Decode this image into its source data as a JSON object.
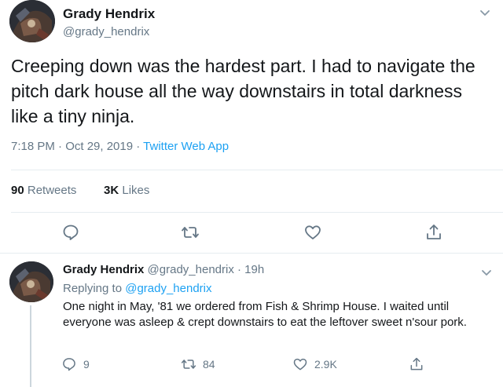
{
  "main_tweet": {
    "author_name": "Grady Hendrix",
    "author_handle": "@grady_hendrix",
    "text": "Creeping down was the hardest part. I had to navigate the pitch dark house all the way downstairs in total darkness like a tiny ninja.",
    "time": "7:18 PM · Oct 29, 2019 · ",
    "source": "Twitter Web App",
    "retweets_count": "90",
    "retweets_label": "Retweets",
    "likes_count": "3K",
    "likes_label": "Likes",
    "icons": [
      "avatar",
      "caret-down-icon",
      "reply-icon",
      "retweet-icon",
      "like-icon",
      "share-icon"
    ]
  },
  "reply_tweet": {
    "author_name": "Grady Hendrix",
    "author_handle": "@grady_hendrix · 19h",
    "replying_prefix": "Replying to ",
    "replying_to": "@grady_hendrix",
    "text": "One night in May, '81 we ordered from Fish & Shrimp House. I waited until everyone was asleep & crept downstairs to eat the leftover sweet n'sour pork.",
    "reply_count": "9",
    "retweet_count": "84",
    "like_count": "2.9K"
  },
  "colors": {
    "text": "#14171a",
    "secondary": "#657786",
    "link": "#1da1f2",
    "divider": "#e6ecf0"
  }
}
